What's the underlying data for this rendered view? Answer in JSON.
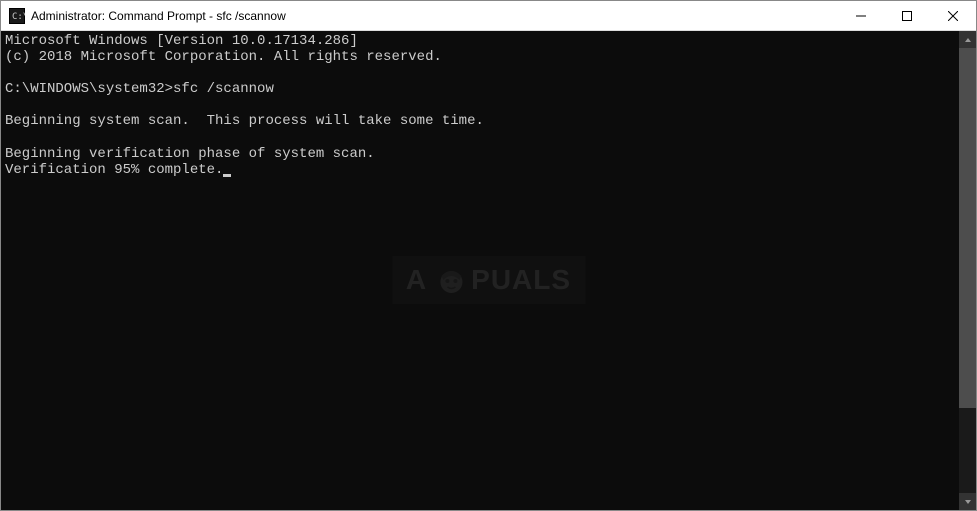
{
  "titlebar": {
    "title": "Administrator: Command Prompt - sfc  /scannow"
  },
  "terminal": {
    "line1": "Microsoft Windows [Version 10.0.17134.286]",
    "line2": "(c) 2018 Microsoft Corporation. All rights reserved.",
    "blank1": "",
    "prompt_line": "C:\\WINDOWS\\system32>sfc /scannow",
    "blank2": "",
    "line3": "Beginning system scan.  This process will take some time.",
    "blank3": "",
    "line4": "Beginning verification phase of system scan.",
    "line5": "Verification 95% complete."
  },
  "watermark": {
    "prefix": "A",
    "suffix": "PUALS"
  }
}
